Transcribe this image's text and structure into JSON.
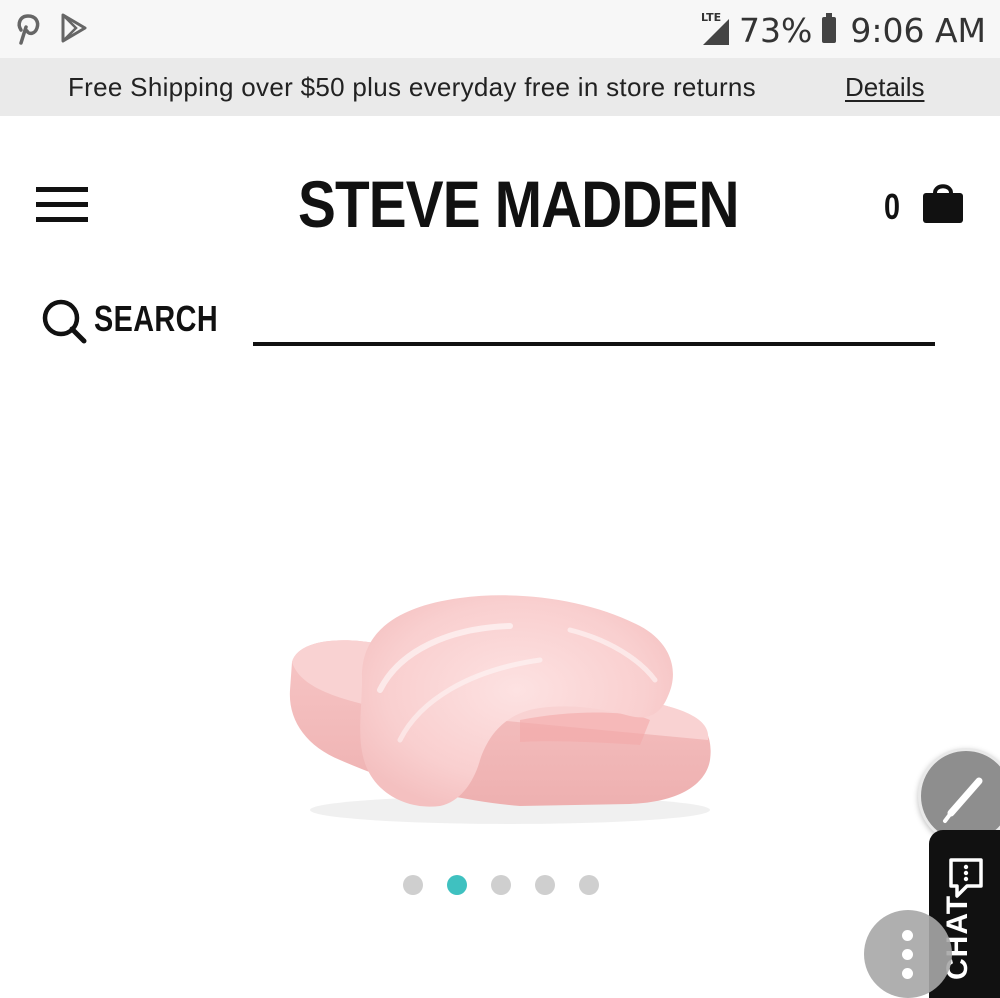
{
  "status_bar": {
    "network": "LTE",
    "battery": "73%",
    "time": "9:06 AM",
    "icons": [
      "pinterest-icon",
      "play-store-icon",
      "signal-icon",
      "battery-icon"
    ]
  },
  "promo": {
    "text": "Free Shipping over $50 plus everyday free in store returns",
    "details_link": "Details"
  },
  "header": {
    "brand": "STEVE MADDEN",
    "cart_count": "0",
    "icons": [
      "menu-icon",
      "shopping-bag-icon"
    ]
  },
  "search": {
    "label": "SEARCH",
    "value": "",
    "icon": "search-icon"
  },
  "product": {
    "image": "pink-faux-fur-slide-sandal",
    "carousel": {
      "total": 5,
      "active_index": 1
    }
  },
  "floating": {
    "chat_label": "CHAT",
    "icons": [
      "pen-icon",
      "chat-icon",
      "more-vertical-icon"
    ]
  },
  "colors": {
    "accent_dot": "#3fc1c0",
    "promo_bg": "#eaeaea",
    "product_pink": "#f7c3c3"
  }
}
